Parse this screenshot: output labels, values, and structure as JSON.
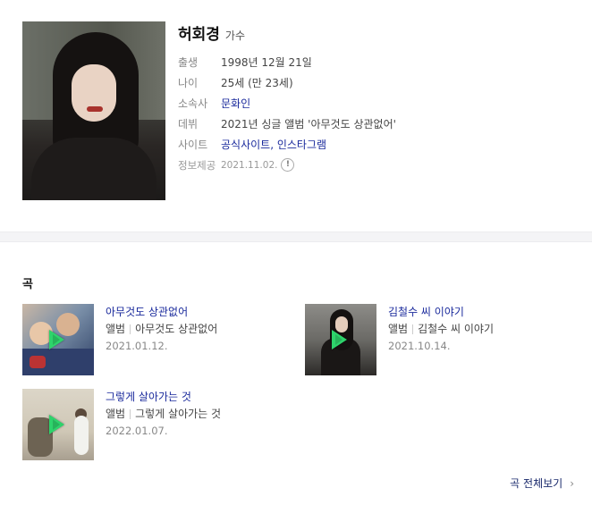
{
  "profile": {
    "name": "허회경",
    "role": "가수",
    "rows": [
      {
        "label": "출생",
        "value": "1998년 12월 21일"
      },
      {
        "label": "나이",
        "value": "25세 (만 23세)"
      },
      {
        "label": "소속사",
        "value": "문화인"
      },
      {
        "label": "데뷔",
        "value": "2021년 싱글 앨범 '아무것도 상관없어'"
      },
      {
        "label": "사이트",
        "value": "공식사이트, 인스타그램"
      }
    ],
    "source_label": "정보제공",
    "source_date": "2021.11.02."
  },
  "songs": {
    "section_title": "곡",
    "items": [
      {
        "title": "아무것도 상관없어",
        "meta_label": "앨범",
        "album": "아무것도 상관없어",
        "date": "2021.01.12."
      },
      {
        "title": "김철수 씨 이야기",
        "meta_label": "앨범",
        "album": "김철수 씨 이야기",
        "date": "2021.10.14."
      },
      {
        "title": "그렇게 살아가는 것",
        "meta_label": "앨범",
        "album": "그렇게 살아가는 것",
        "date": "2022.01.07."
      }
    ],
    "more_label": "곡 전체보기",
    "more_icon": "chevron-right-icon"
  },
  "colors": {
    "link": "#1a2a9c",
    "play": "#2ed36b"
  }
}
